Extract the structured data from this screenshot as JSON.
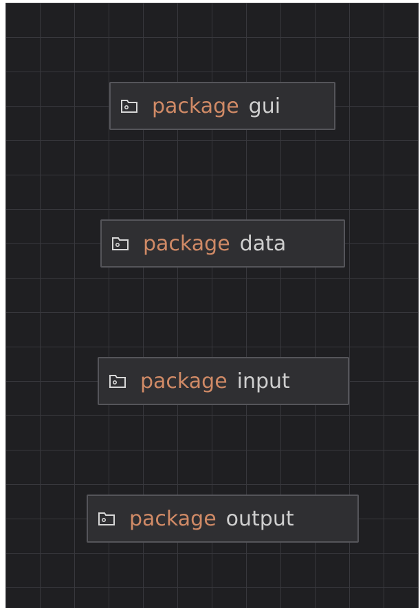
{
  "colors": {
    "canvas_background": "#1f1f22",
    "grid_line": "#38383d",
    "node_background": "#2f2f32",
    "node_border": "#55555a",
    "keyword": "#d08a66",
    "package_name": "#cfcfcf",
    "icon": "#d8d8d8"
  },
  "nodes": [
    {
      "icon": "folder-icon",
      "keyword": "package",
      "name": "gui"
    },
    {
      "icon": "folder-icon",
      "keyword": "package",
      "name": "data"
    },
    {
      "icon": "folder-icon",
      "keyword": "package",
      "name": "input"
    },
    {
      "icon": "folder-icon",
      "keyword": "package",
      "name": "output"
    }
  ]
}
